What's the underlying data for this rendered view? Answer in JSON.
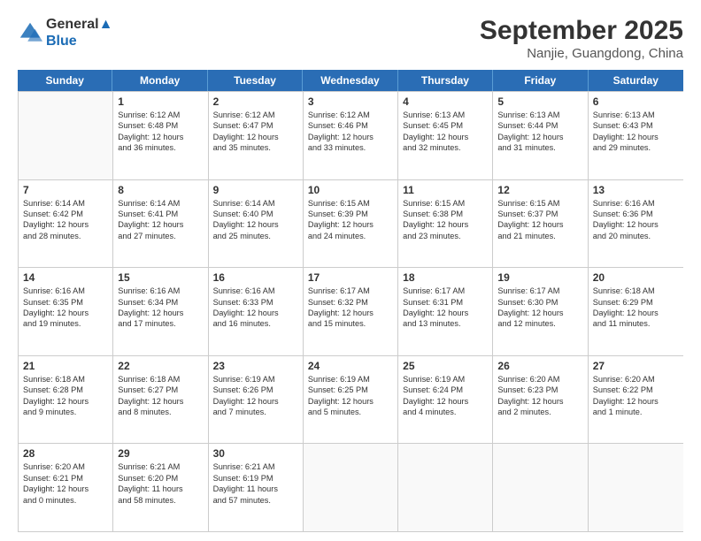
{
  "logo": {
    "line1": "General",
    "line2": "Blue"
  },
  "title": "September 2025",
  "location": "Nanjie, Guangdong, China",
  "header_days": [
    "Sunday",
    "Monday",
    "Tuesday",
    "Wednesday",
    "Thursday",
    "Friday",
    "Saturday"
  ],
  "weeks": [
    [
      {
        "day": "",
        "info": ""
      },
      {
        "day": "1",
        "info": "Sunrise: 6:12 AM\nSunset: 6:48 PM\nDaylight: 12 hours\nand 36 minutes."
      },
      {
        "day": "2",
        "info": "Sunrise: 6:12 AM\nSunset: 6:47 PM\nDaylight: 12 hours\nand 35 minutes."
      },
      {
        "day": "3",
        "info": "Sunrise: 6:12 AM\nSunset: 6:46 PM\nDaylight: 12 hours\nand 33 minutes."
      },
      {
        "day": "4",
        "info": "Sunrise: 6:13 AM\nSunset: 6:45 PM\nDaylight: 12 hours\nand 32 minutes."
      },
      {
        "day": "5",
        "info": "Sunrise: 6:13 AM\nSunset: 6:44 PM\nDaylight: 12 hours\nand 31 minutes."
      },
      {
        "day": "6",
        "info": "Sunrise: 6:13 AM\nSunset: 6:43 PM\nDaylight: 12 hours\nand 29 minutes."
      }
    ],
    [
      {
        "day": "7",
        "info": "Sunrise: 6:14 AM\nSunset: 6:42 PM\nDaylight: 12 hours\nand 28 minutes."
      },
      {
        "day": "8",
        "info": "Sunrise: 6:14 AM\nSunset: 6:41 PM\nDaylight: 12 hours\nand 27 minutes."
      },
      {
        "day": "9",
        "info": "Sunrise: 6:14 AM\nSunset: 6:40 PM\nDaylight: 12 hours\nand 25 minutes."
      },
      {
        "day": "10",
        "info": "Sunrise: 6:15 AM\nSunset: 6:39 PM\nDaylight: 12 hours\nand 24 minutes."
      },
      {
        "day": "11",
        "info": "Sunrise: 6:15 AM\nSunset: 6:38 PM\nDaylight: 12 hours\nand 23 minutes."
      },
      {
        "day": "12",
        "info": "Sunrise: 6:15 AM\nSunset: 6:37 PM\nDaylight: 12 hours\nand 21 minutes."
      },
      {
        "day": "13",
        "info": "Sunrise: 6:16 AM\nSunset: 6:36 PM\nDaylight: 12 hours\nand 20 minutes."
      }
    ],
    [
      {
        "day": "14",
        "info": "Sunrise: 6:16 AM\nSunset: 6:35 PM\nDaylight: 12 hours\nand 19 minutes."
      },
      {
        "day": "15",
        "info": "Sunrise: 6:16 AM\nSunset: 6:34 PM\nDaylight: 12 hours\nand 17 minutes."
      },
      {
        "day": "16",
        "info": "Sunrise: 6:16 AM\nSunset: 6:33 PM\nDaylight: 12 hours\nand 16 minutes."
      },
      {
        "day": "17",
        "info": "Sunrise: 6:17 AM\nSunset: 6:32 PM\nDaylight: 12 hours\nand 15 minutes."
      },
      {
        "day": "18",
        "info": "Sunrise: 6:17 AM\nSunset: 6:31 PM\nDaylight: 12 hours\nand 13 minutes."
      },
      {
        "day": "19",
        "info": "Sunrise: 6:17 AM\nSunset: 6:30 PM\nDaylight: 12 hours\nand 12 minutes."
      },
      {
        "day": "20",
        "info": "Sunrise: 6:18 AM\nSunset: 6:29 PM\nDaylight: 12 hours\nand 11 minutes."
      }
    ],
    [
      {
        "day": "21",
        "info": "Sunrise: 6:18 AM\nSunset: 6:28 PM\nDaylight: 12 hours\nand 9 minutes."
      },
      {
        "day": "22",
        "info": "Sunrise: 6:18 AM\nSunset: 6:27 PM\nDaylight: 12 hours\nand 8 minutes."
      },
      {
        "day": "23",
        "info": "Sunrise: 6:19 AM\nSunset: 6:26 PM\nDaylight: 12 hours\nand 7 minutes."
      },
      {
        "day": "24",
        "info": "Sunrise: 6:19 AM\nSunset: 6:25 PM\nDaylight: 12 hours\nand 5 minutes."
      },
      {
        "day": "25",
        "info": "Sunrise: 6:19 AM\nSunset: 6:24 PM\nDaylight: 12 hours\nand 4 minutes."
      },
      {
        "day": "26",
        "info": "Sunrise: 6:20 AM\nSunset: 6:23 PM\nDaylight: 12 hours\nand 2 minutes."
      },
      {
        "day": "27",
        "info": "Sunrise: 6:20 AM\nSunset: 6:22 PM\nDaylight: 12 hours\nand 1 minute."
      }
    ],
    [
      {
        "day": "28",
        "info": "Sunrise: 6:20 AM\nSunset: 6:21 PM\nDaylight: 12 hours\nand 0 minutes."
      },
      {
        "day": "29",
        "info": "Sunrise: 6:21 AM\nSunset: 6:20 PM\nDaylight: 11 hours\nand 58 minutes."
      },
      {
        "day": "30",
        "info": "Sunrise: 6:21 AM\nSunset: 6:19 PM\nDaylight: 11 hours\nand 57 minutes."
      },
      {
        "day": "",
        "info": ""
      },
      {
        "day": "",
        "info": ""
      },
      {
        "day": "",
        "info": ""
      },
      {
        "day": "",
        "info": ""
      }
    ]
  ]
}
